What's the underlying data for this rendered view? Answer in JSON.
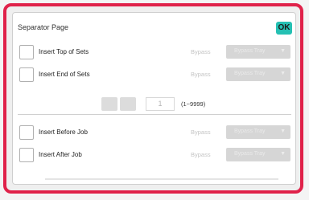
{
  "dialog": {
    "title": "Separator Page",
    "ok_label": "OK"
  },
  "options": [
    {
      "label": "Insert Top of Sets",
      "bypass_label": "Bypass",
      "tray_value": "Bypass Tray",
      "checked": false
    },
    {
      "label": "Insert End of Sets",
      "bypass_label": "Bypass",
      "tray_value": "Bypass Tray",
      "checked": false
    },
    {
      "label": "Insert Before Job",
      "bypass_label": "Bypass",
      "tray_value": "Bypass Tray",
      "checked": false
    },
    {
      "label": "Insert After Job",
      "bypass_label": "Bypass",
      "tray_value": "Bypass Tray",
      "checked": false
    }
  ],
  "quantity": {
    "value": "1",
    "range": "(1~9999)"
  },
  "colors": {
    "frame_border": "#e0224a",
    "ok_button": "#25c0b3"
  }
}
